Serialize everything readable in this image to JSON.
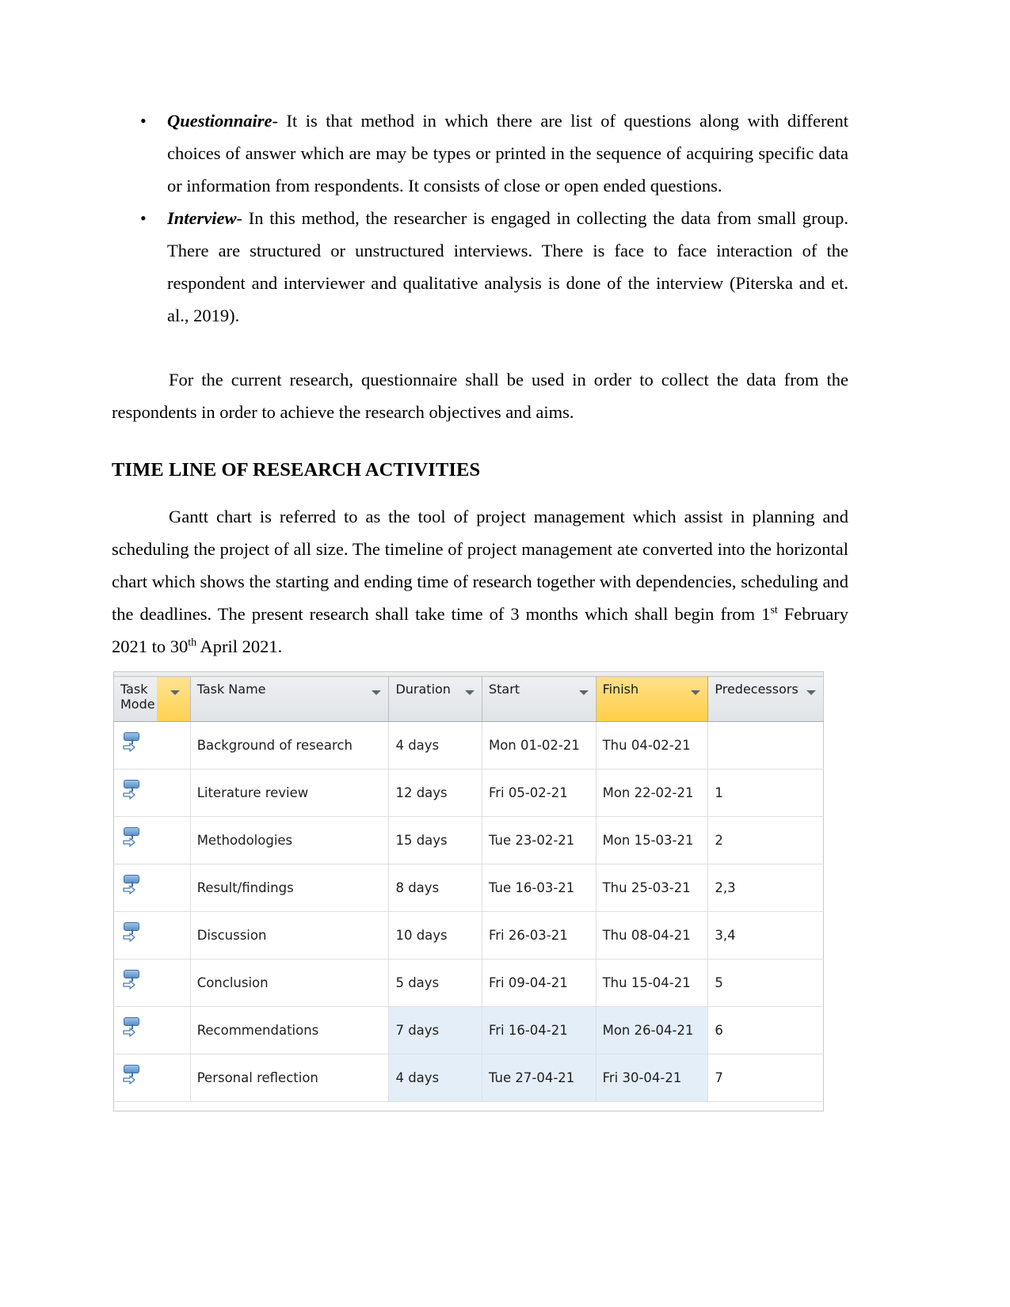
{
  "document": {
    "bullets": [
      {
        "marker": "•",
        "term": "Questionnaire",
        "text": "- It is that method in which there are list of questions along with different choices of answer which are may be types or printed in the sequence of acquiring specific data or information from respondents. It consists of close or open ended questions."
      },
      {
        "marker": "•",
        "term": "Interview",
        "text": "- In this method, the researcher is engaged in collecting the data from small group. There are structured or unstructured interviews. There is face to face interaction of the respondent and interviewer and qualitative analysis is done of the interview (Piterska and et. al., 2019)."
      }
    ],
    "paragraph_questionnaire_use": "For the current research, questionnaire shall be used in order to collect the data from the respondents in order to achieve the research objectives and aims.",
    "heading": "TIME LINE OF RESEARCH ACTIVITIES",
    "paragraph_gantt_part1": "Gantt chart is referred to as the tool of project management which assist in planning and scheduling the project of all size. The timeline of project management ate converted into the horizontal chart which shows the starting and ending time of research together with dependencies, scheduling and the deadlines. The present research shall take time of 3 months which shall begin from 1",
    "ordinal_first": "st",
    "paragraph_gantt_part2": " February 2021 to 30",
    "ordinal_thirtieth": "th",
    "paragraph_gantt_part3": " April 2021."
  },
  "gantt_table": {
    "columns": [
      {
        "key": "task_mode",
        "label": "Task Mode",
        "highlight": false
      },
      {
        "key": "filter_flag",
        "label": "",
        "highlight": true
      },
      {
        "key": "task_name",
        "label": "Task Name",
        "highlight": false
      },
      {
        "key": "duration",
        "label": "Duration",
        "highlight": false
      },
      {
        "key": "start",
        "label": "Start",
        "highlight": false
      },
      {
        "key": "finish",
        "label": "Finish",
        "highlight": true
      },
      {
        "key": "predecessors",
        "label": "Predecessors",
        "highlight": false
      }
    ],
    "filter_icon": "chevron-down-icon",
    "mode_icon": "manually-scheduled-icon",
    "highlight_color": "#ffd14f",
    "selection_color": "#e4eef8",
    "rows": [
      {
        "task_name": "Background of research",
        "duration": "4 days",
        "start": "Mon 01-02-21",
        "finish": "Thu 04-02-21",
        "predecessors": "",
        "selected": false
      },
      {
        "task_name": "Literature review",
        "duration": "12 days",
        "start": "Fri 05-02-21",
        "finish": "Mon 22-02-21",
        "predecessors": "1",
        "selected": false
      },
      {
        "task_name": "Methodologies",
        "duration": "15 days",
        "start": "Tue 23-02-21",
        "finish": "Mon 15-03-21",
        "predecessors": "2",
        "selected": false
      },
      {
        "task_name": "Result/findings",
        "duration": "8 days",
        "start": "Tue 16-03-21",
        "finish": "Thu 25-03-21",
        "predecessors": "2,3",
        "selected": false
      },
      {
        "task_name": "Discussion",
        "duration": "10 days",
        "start": "Fri 26-03-21",
        "finish": "Thu 08-04-21",
        "predecessors": "3,4",
        "selected": false
      },
      {
        "task_name": "Conclusion",
        "duration": "5 days",
        "start": "Fri 09-04-21",
        "finish": "Thu 15-04-21",
        "predecessors": "5",
        "selected": false
      },
      {
        "task_name": "Recommendations",
        "duration": "7 days",
        "start": "Fri 16-04-21",
        "finish": "Mon 26-04-21",
        "predecessors": "6",
        "selected": true
      },
      {
        "task_name": "Personal reflection",
        "duration": "4 days",
        "start": "Tue 27-04-21",
        "finish": "Fri 30-04-21",
        "predecessors": "7",
        "selected": true
      }
    ]
  }
}
